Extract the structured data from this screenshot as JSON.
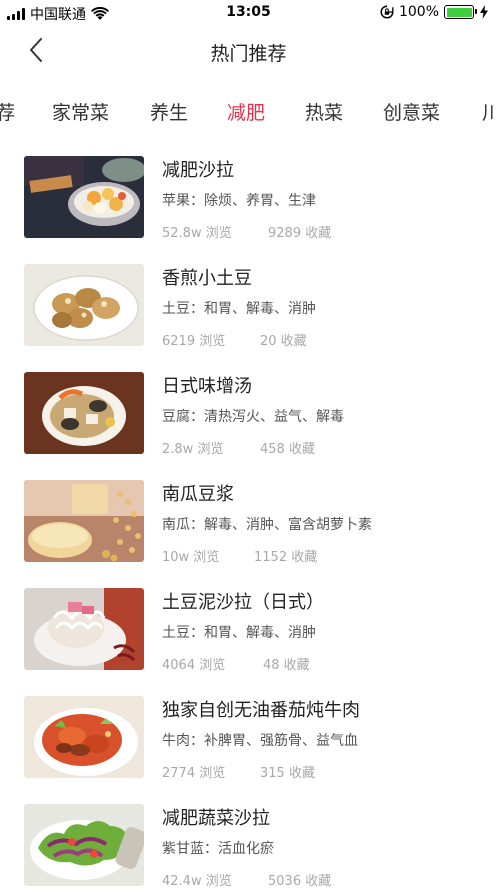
{
  "status": {
    "carrier": "中国联通",
    "time": "13:05",
    "battery": "100%"
  },
  "nav": {
    "title": "热门推荐"
  },
  "tabs": [
    {
      "label": "荐"
    },
    {
      "label": "家常菜"
    },
    {
      "label": "养生"
    },
    {
      "label": "减肥",
      "active": true
    },
    {
      "label": "热菜"
    },
    {
      "label": "创意菜"
    },
    {
      "label": "川"
    }
  ],
  "colors": {
    "accent": "#e8304d",
    "meta": "#a8a8a8"
  },
  "recipes": [
    {
      "title": "减肥沙拉",
      "desc": "苹果：除烦、养胃、生津",
      "views": "52.8w 浏览",
      "favs": "9289 收藏"
    },
    {
      "title": "香煎小土豆",
      "desc": "土豆：和胃、解毒、消肿",
      "views": "6219 浏览",
      "favs": "20 收藏"
    },
    {
      "title": "日式味增汤",
      "desc": "豆腐：清热泻火、益气、解毒",
      "views": "2.8w 浏览",
      "favs": "458 收藏"
    },
    {
      "title": "南瓜豆浆",
      "desc": "南瓜：解毒、消肿、富含胡萝卜素",
      "views": "10w 浏览",
      "favs": "1152 收藏"
    },
    {
      "title": "土豆泥沙拉（日式）",
      "desc": "土豆：和胃、解毒、消肿",
      "views": "4064 浏览",
      "favs": "48 收藏"
    },
    {
      "title": "独家自创无油番茄炖牛肉",
      "desc": "牛肉：补脾胃、强筋骨、益气血",
      "views": "2774 浏览",
      "favs": "315 收藏"
    },
    {
      "title": "减肥蔬菜沙拉",
      "desc": "紫甘蓝：活血化瘀",
      "views": "42.4w 浏览",
      "favs": "5036 收藏"
    }
  ]
}
